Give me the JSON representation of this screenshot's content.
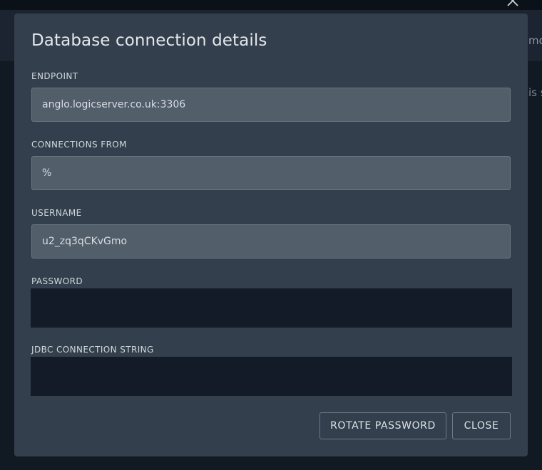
{
  "background": {
    "header_text_fragment": "mo",
    "body_text_fragment": "is s"
  },
  "modal": {
    "title": "Database connection details",
    "fields": [
      {
        "label": "ENDPOINT",
        "value": "anglo.logicserver.co.uk:3306"
      },
      {
        "label": "CONNECTIONS FROM",
        "value": "%"
      },
      {
        "label": "USERNAME",
        "value": "u2_zq3qCKvGmo"
      },
      {
        "label": "PASSWORD",
        "value": ""
      },
      {
        "label": "JDBC CONNECTION STRING",
        "value": ""
      }
    ],
    "buttons": {
      "rotate_password": "ROTATE PASSWORD",
      "close": "CLOSE"
    }
  },
  "colors": {
    "overlay": "#111923",
    "modal_bg": "#333f4c",
    "input_bg": "#535e6b",
    "masked_field_bg": "#131a28"
  },
  "icons": {
    "background_close": "close-icon"
  }
}
